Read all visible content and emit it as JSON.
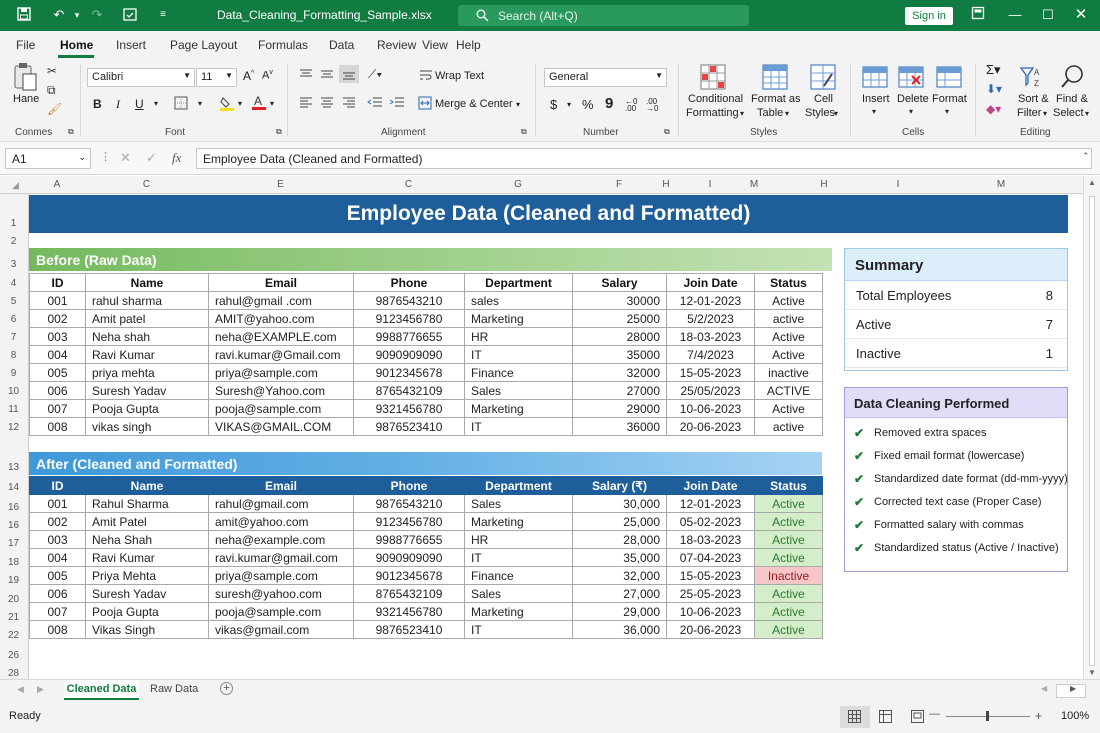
{
  "window": {
    "title": "Data_Cleaning_Formatting_Sample.xlsx",
    "search_placeholder": "Search (Alt+Q)",
    "signin": "Sign in"
  },
  "ribbon_tabs": [
    "File",
    "Home",
    "Insert",
    "Page Layout",
    "Formulas",
    "Data",
    "Review",
    "View",
    "Help"
  ],
  "ribbon": {
    "clipboard": {
      "paste": "Hane",
      "label": "Conmes"
    },
    "font": {
      "name": "Calibri",
      "size": "11",
      "label": "Font"
    },
    "alignment": {
      "wrap": "Wrap Text",
      "merge": "Merge & Center",
      "label": "Alignment"
    },
    "number": {
      "format": "General",
      "label": "Number"
    },
    "styles": {
      "conditional": "Conditional",
      "conditional2": "Formatting",
      "format_as": "Format as",
      "format_as2": "Table",
      "cell": "Cell",
      "cell2": "Styles",
      "label": "Styles"
    },
    "cells": {
      "insert": "Insert",
      "delete": "Delete",
      "format": "Format",
      "label": "Cells"
    },
    "editing": {
      "sort": "Sort &",
      "sort2": "Filter",
      "find": "Find &",
      "find2": "Select",
      "label": "Editing"
    }
  },
  "formula_bar": {
    "name_box": "A1",
    "value": "Employee Data (Cleaned and Formatted)"
  },
  "columns": [
    "A",
    "C",
    "E",
    "C",
    "G",
    "F",
    "H",
    "I",
    "M",
    "H",
    "I",
    "M"
  ],
  "rows": [
    "1",
    "2",
    "3",
    "4",
    "5",
    "6",
    "7",
    "8",
    "9",
    "10",
    "11",
    "12",
    "13",
    "14",
    "16",
    "16",
    "17",
    "18",
    "19",
    "20",
    "21",
    "22",
    "26",
    "28"
  ],
  "sheet": {
    "title": "Employee Data (Cleaned and Formatted)",
    "before_label": "Before (Raw Data)",
    "after_label": "After (Cleaned and Formatted)",
    "before_headers": [
      "ID",
      "Name",
      "Email",
      "Phone",
      "Department",
      "Salary",
      "Join Date",
      "Status"
    ],
    "after_headers": [
      "ID",
      "Name",
      "Email",
      "Phone",
      "Department",
      "Salary (₹)",
      "Join Date",
      "Status"
    ],
    "before_rows": [
      [
        "001",
        "rahul sharma",
        "rahul@gmail .com",
        "9876543210",
        "sales",
        "30000",
        "12-01-2023",
        "Active"
      ],
      [
        "002",
        "Amit patel",
        "AMIT@yahoo.com",
        "9123456780",
        "Marketing",
        "25000",
        "5/2/2023",
        "active"
      ],
      [
        "003",
        "Neha  shah",
        "neha@EXAMPLE.com",
        "9988776655",
        "HR",
        "28000",
        "18-03-2023",
        "Active"
      ],
      [
        "004",
        "Ravi Kumar",
        "ravi.kumar@Gmail.com",
        "9090909090",
        "IT",
        "35000",
        "7/4/2023",
        "Active"
      ],
      [
        "005",
        "priya mehta",
        "priya@sample.com",
        "9012345678",
        "Finance",
        "32000",
        "15-05-2023",
        "inactive"
      ],
      [
        "006",
        "Suresh Yadav",
        "Suresh@Yahoo.com",
        "8765432109",
        "Sales",
        "27000",
        "25/05/2023",
        "ACTIVE"
      ],
      [
        "007",
        "Pooja Gupta",
        "pooja@sample.com",
        "9321456780",
        "Marketing",
        "29000",
        "10-06-2023",
        "Active"
      ],
      [
        "008",
        "vikas singh",
        "VIKAS@GMAIL.COM",
        "9876523410",
        "IT",
        "36000",
        "20-06-2023",
        "active"
      ]
    ],
    "after_rows": [
      [
        "001",
        "Rahul Sharma",
        "rahul@gmail.com",
        "9876543210",
        "Sales",
        "30,000",
        "12-01-2023",
        "Active"
      ],
      [
        "002",
        "Amit Patel",
        "amit@yahoo.com",
        "9123456780",
        "Marketing",
        "25,000",
        "05-02-2023",
        "Active"
      ],
      [
        "003",
        "Neha Shah",
        "neha@example.com",
        "9988776655",
        "HR",
        "28,000",
        "18-03-2023",
        "Active"
      ],
      [
        "004",
        "Ravi Kumar",
        "ravi.kumar@gmail.com",
        "9090909090",
        "IT",
        "35,000",
        "07-04-2023",
        "Active"
      ],
      [
        "005",
        "Priya Mehta",
        "priya@sample.com",
        "9012345678",
        "Finance",
        "32,000",
        "15-05-2023",
        "Inactive"
      ],
      [
        "006",
        "Suresh Yadav",
        "suresh@yahoo.com",
        "8765432109",
        "Sales",
        "27,000",
        "25-05-2023",
        "Active"
      ],
      [
        "007",
        "Pooja Gupta",
        "pooja@sample.com",
        "9321456780",
        "Marketing",
        "29,000",
        "10-06-2023",
        "Active"
      ],
      [
        "008",
        "Vikas Singh",
        "vikas@gmail.com",
        "9876523410",
        "IT",
        "36,000",
        "20-06-2023",
        "Active"
      ]
    ]
  },
  "summary": {
    "title": "Summary",
    "rows": [
      {
        "label": "Total Employees",
        "value": "8"
      },
      {
        "label": "Active",
        "value": "7"
      },
      {
        "label": "Inactive",
        "value": "1"
      }
    ]
  },
  "cleaning": {
    "title": "Data Cleaning Performed",
    "items": [
      "Removed extra spaces",
      "Fixed email format (lowercase)",
      "Standardized date format (dd-mm-yyyy)",
      "Corrected text case (Proper Case)",
      "Formatted salary with commas",
      "Standardized status (Active / Inactive)"
    ]
  },
  "sheet_tabs": [
    "Cleaned Data",
    "Raw Data"
  ],
  "status": {
    "ready": "Ready",
    "zoom": "100%"
  },
  "colors": {
    "accent": "#107c41",
    "banner": "#1d5e9b",
    "active_bg": "#d4edcb",
    "inactive_bg": "#f6c6c9"
  }
}
